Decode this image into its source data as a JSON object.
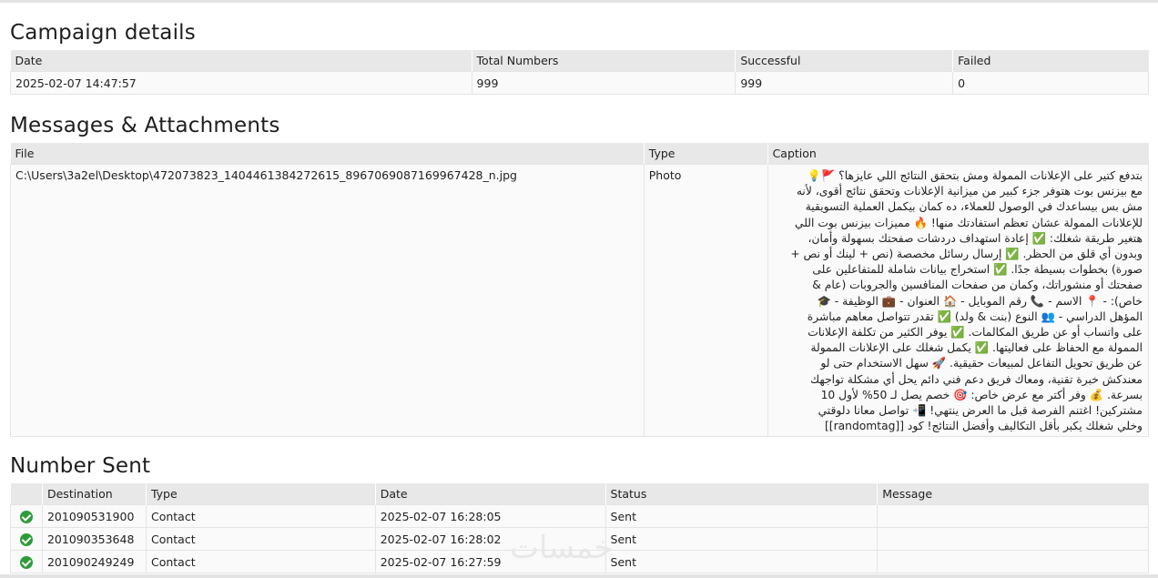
{
  "campaign": {
    "title": "Campaign details",
    "headers": [
      "Date",
      "Total Numbers",
      "Successful",
      "Failed"
    ],
    "row": [
      "2025-02-07 14:47:57",
      "999",
      "999",
      "0"
    ]
  },
  "messages": {
    "title": "Messages & Attachments",
    "headers": [
      "File",
      "Type",
      "Caption"
    ],
    "file": "C:\\Users\\3a2el\\Desktop\\472073823_1404461384272615_8967069087169967428_n.jpg",
    "type": "Photo",
    "caption": "بتدفع كتير على الإعلانات الممولة ومش بتحقق النتائج اللي عايزها؟ 🚩💡\nمع بيزنس بوت هتوفر جزء كبير من ميزانية الإعلانات وتحقق نتائج أقوى، لأنه\nمش بس بيساعدك في الوصول للعملاء، ده كمان بيكمل العملية التسويقية\nللإعلانات الممولة عشان تعظم استفادتك منها! 🔥 مميزات بيزنس بوت اللي\nهتغير طريقة شغلك: ✅ إعادة استهداف دردشات صفحتك بسهولة وأمان،\nوبدون أي قلق من الحظر. ✅ إرسال رسائل مخصصة (نص + لينك أو نص +\nصورة) بخطوات بسيطة جدًا. ✅ استخراج بيانات شاملة للمتفاعلين على\nصفحتك أو منشوراتك، وكمان من صفحات المنافسين والجروبات (عام &\nخاص): - 📍 الاسم - 📞 رقم الموبايل - 🏠 العنوان - 💼 الوظيفة - 🎓\nالمؤهل الدراسي - 👥 النوع (بنت & ولد) ✅ تقدر تتواصل معاهم مباشرة\nعلى واتساب أو عن طريق المكالمات. ✅ يوفر الكثير من تكلفة الإعلانات\nالممولة مع الحفاظ على فعاليتها. ✅ يكمل شغلك على الإعلانات الممولة\nعن طريق تحويل التفاعل لمبيعات حقيقية. 🚀 سهل الاستخدام حتى لو\nمعندكش خبرة تقنية، ومعاك فريق دعم فني دائم يحل أي مشكلة تواجهك\nبسرعة. 💰 وفر أكتر مع عرض خاص: 🎯 خصم يصل لـ 50% لأول 10\nمشتركين! اغتنم الفرصة قبل ما العرض ينتهي! 📲 تواصل معانا دلوقتي\nوخلي شغلك يكبر بأقل التكاليف وأفضل النتائج! كود [[randomtag]]"
  },
  "numbers": {
    "title": "Number Sent",
    "headers": [
      "",
      "Destination",
      "Type",
      "Date",
      "Status",
      "Message"
    ],
    "rows": [
      {
        "destination": "201090531900",
        "type": "Contact",
        "date": "2025-02-07 16:28:05",
        "status": "Sent",
        "message": ""
      },
      {
        "destination": "201090353648",
        "type": "Contact",
        "date": "2025-02-07 16:28:02",
        "status": "Sent",
        "message": ""
      },
      {
        "destination": "201090249249",
        "type": "Contact",
        "date": "2025-02-07 16:27:59",
        "status": "Sent",
        "message": ""
      }
    ]
  },
  "watermark": "خمسات",
  "colors": {
    "success": "#2e9b3a",
    "header_bg": "#e8e8e8"
  },
  "icons": {
    "status": "check-circle-icon"
  }
}
